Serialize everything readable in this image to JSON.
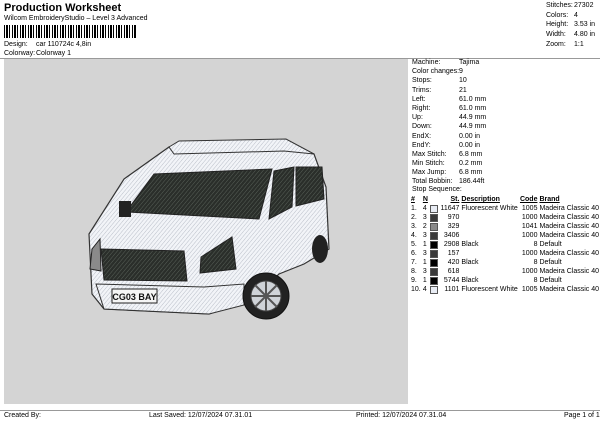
{
  "header": {
    "title": "Production Worksheet",
    "subtitle": "Wilcom EmbroideryStudio – Level 3 Advanced",
    "design_label": "Design:",
    "design_value": "car 110724c 4,8in",
    "colorway_label": "Colorway:",
    "colorway_value": "Colorway 1"
  },
  "stats": [
    {
      "label": "Stitches:",
      "value": "27302"
    },
    {
      "label": "Colors:",
      "value": "4"
    },
    {
      "label": "Height:",
      "value": "3.53 in"
    },
    {
      "label": "Width:",
      "value": "4.80 in"
    },
    {
      "label": "Zoom:",
      "value": "1:1"
    }
  ],
  "machine_info": [
    {
      "label": "Machine:",
      "value": "Tajima"
    },
    {
      "label": "Color changes:",
      "value": "9"
    },
    {
      "label": "Stops:",
      "value": "10"
    },
    {
      "label": "Trims:",
      "value": "21"
    },
    {
      "label": "Left:",
      "value": "61.0 mm"
    },
    {
      "label": "Right:",
      "value": "61.0 mm"
    },
    {
      "label": "Up:",
      "value": "44.9 mm"
    },
    {
      "label": "Down:",
      "value": "44.9 mm"
    },
    {
      "label": "EndX:",
      "value": "0.00 in"
    },
    {
      "label": "EndY:",
      "value": "0.00 in"
    },
    {
      "label": "Max Stitch:",
      "value": "6.8 mm"
    },
    {
      "label": "Min Stitch:",
      "value": "0.2 mm"
    },
    {
      "label": "Max Jump:",
      "value": "6.8 mm"
    },
    {
      "label": "Total Bobbin:",
      "value": "186.44ft"
    }
  ],
  "sequence": {
    "title": "Stop Sequence:",
    "headers": [
      "#",
      "N",
      "",
      "St.",
      "Description",
      "Code",
      "Brand"
    ],
    "rows": [
      {
        "num": "1.",
        "n": "4",
        "color": "#e8ecf4",
        "st": "11647",
        "desc": "Fluorescent White",
        "code": "1005",
        "brand": "Madeira Classic 40"
      },
      {
        "num": "2.",
        "n": "3",
        "color": "#3a3a3a",
        "st": "970",
        "desc": "",
        "code": "1000",
        "brand": "Madeira Classic 40"
      },
      {
        "num": "3.",
        "n": "2",
        "color": "#8a8a8a",
        "st": "329",
        "desc": "",
        "code": "1041",
        "brand": "Madeira Classic 40"
      },
      {
        "num": "4.",
        "n": "3",
        "color": "#3a3a3a",
        "st": "3406",
        "desc": "",
        "code": "1000",
        "brand": "Madeira Classic 40"
      },
      {
        "num": "5.",
        "n": "1",
        "color": "#000000",
        "st": "2908",
        "desc": "Black",
        "code": "8",
        "brand": "Default"
      },
      {
        "num": "6.",
        "n": "3",
        "color": "#3a3a3a",
        "st": "157",
        "desc": "",
        "code": "1000",
        "brand": "Madeira Classic 40"
      },
      {
        "num": "7.",
        "n": "1",
        "color": "#000000",
        "st": "420",
        "desc": "Black",
        "code": "8",
        "brand": "Default"
      },
      {
        "num": "8.",
        "n": "3",
        "color": "#3a3a3a",
        "st": "618",
        "desc": "",
        "code": "1000",
        "brand": "Madeira Classic 40"
      },
      {
        "num": "9.",
        "n": "1",
        "color": "#000000",
        "st": "5744",
        "desc": "Black",
        "code": "8",
        "brand": "Default"
      },
      {
        "num": "10.",
        "n": "4",
        "color": "#e8ecf4",
        "st": "1101",
        "desc": "Fluorescent White",
        "code": "1005",
        "brand": "Madeira Classic 40"
      }
    ]
  },
  "design_preview": {
    "plate_text": "CG03 BAY"
  },
  "footer": {
    "created_by": "Created By:",
    "last_saved": "Last Saved: 12/07/2024 07.31.01",
    "printed": "Printed: 12/07/2024 07.31.04",
    "page": "Page 1 of 1"
  }
}
